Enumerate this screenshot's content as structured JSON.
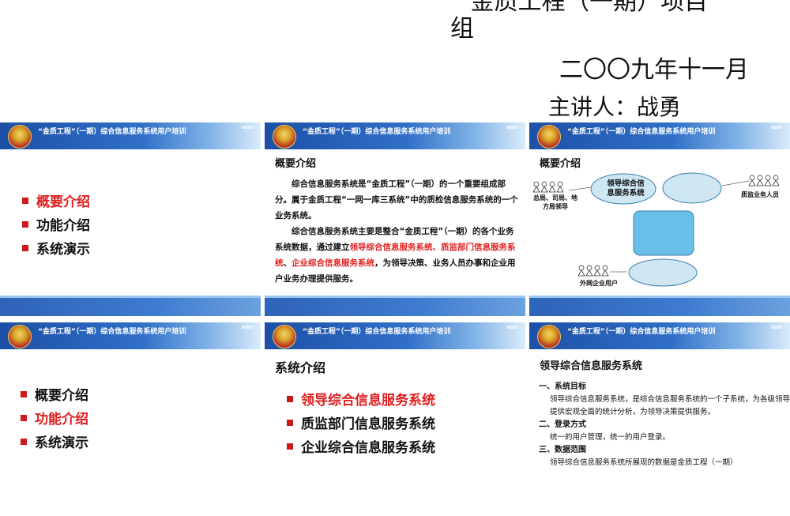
{
  "cover": {
    "line1": "“金质工程”（一期）项目",
    "line2": "组",
    "date": "二〇〇九年十一月",
    "speaker": "主讲人：战勇"
  },
  "banner_title": "“金质工程”（一期）综合信息服务系统用户培训",
  "slide1": {
    "items": [
      "概要介绍",
      "功能介绍",
      "系统演示"
    ]
  },
  "slide2": {
    "heading": "概要介绍",
    "p1": "综合信息服务系统是“金质工程”（一期）的一个重要组成部分。属于金质工程“一网一库三系统”中的质检信息服务系统的一个业务系统。",
    "p2a": "综合信息服务系统主要是整合“金质工程”（一期）的各个业务系统数据，通过建立",
    "p2b": "领导综合信息服务系统、质监部门信息服务系统",
    "p2c": "、",
    "p2d": "企业综合信息服务系统",
    "p2e": "，为领导决策、业务人员办事和企业用户业务办理提供服务。"
  },
  "slide3": {
    "heading": "概要介绍",
    "leader_label": "总局、司局、地方局领导",
    "ellipse_label": "领导综合信息服务系统",
    "staff_label": "质监业务人员",
    "enterprise_label": "外网企业用户"
  },
  "slide4": {
    "items": [
      "概要介绍",
      "功能介绍",
      "系统演示"
    ]
  },
  "slide5": {
    "heading": "系统介绍",
    "items": [
      "领导综合信息服务系统",
      "质监部门信息服务系统",
      "企业综合信息服务系统"
    ]
  },
  "slide6": {
    "heading": "领导综合信息服务系统",
    "s1_title": "一、系统目标",
    "s1_body": "领导综合信息服务系统，是综合信息服务系统的一个子系统，为各级领导提供宏观全面的统计分析，为领导决策提供服务。",
    "s2_title": "二、登录方式",
    "s2_body": "统一的用户管理，统一的用户登录。",
    "s3_title": "三、数据范围",
    "s3_body": "领导综合信息服务系统所展现的数据是金质工程（一期）"
  },
  "colors": {
    "accent_red": "#e01e1e",
    "banner_blue": "#1d4fa6",
    "node_fill": "#cfe7f2"
  }
}
